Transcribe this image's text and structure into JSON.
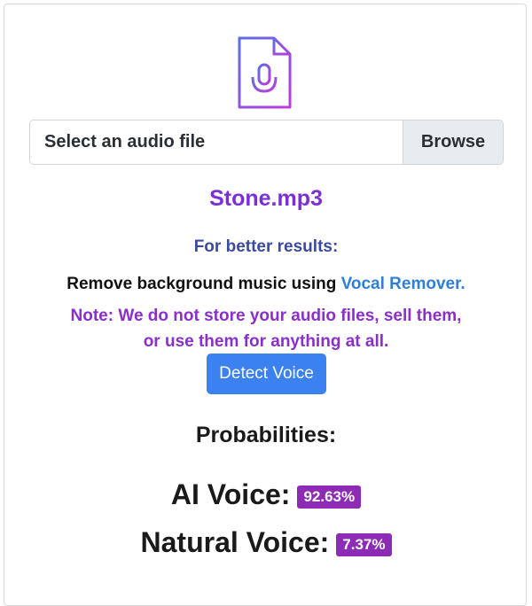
{
  "upload": {
    "icon": "audio-file-icon",
    "input_label": "Select an audio file",
    "browse_label": "Browse"
  },
  "file": {
    "name": "Stone.mp3"
  },
  "tips": {
    "heading": "For better results:",
    "remove_prefix": "Remove background music using ",
    "remove_link": "Vocal Remover.",
    "note_line1": "Note: We do not store your audio files, sell them,",
    "note_line2": "or use them for anything at all."
  },
  "actions": {
    "detect_label": "Detect Voice"
  },
  "results": {
    "heading": "Probabilities:",
    "ai_label": "AI Voice:",
    "ai_value": "92.63%",
    "natural_label": "Natural Voice:",
    "natural_value": "7.37%"
  },
  "colors": {
    "accent_purple": "#7b2fd6",
    "badge_purple": "#8e2bb5",
    "button_blue": "#3b82f0",
    "link_blue": "#2f7fd6"
  }
}
